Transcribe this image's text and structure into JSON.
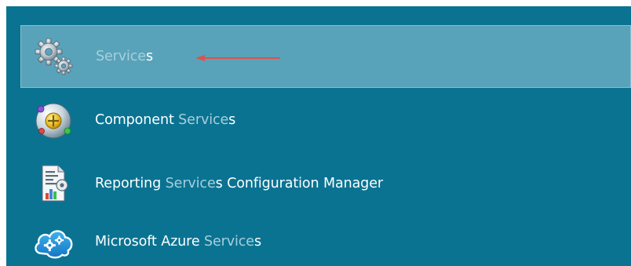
{
  "results": [
    {
      "id": "services",
      "prefix": "",
      "match": "Service",
      "suffix": "s",
      "selected": true,
      "icon": "gears-icon"
    },
    {
      "id": "component-services",
      "prefix": "Component ",
      "match": "Service",
      "suffix": "s",
      "selected": false,
      "icon": "component-services-icon"
    },
    {
      "id": "reporting-services",
      "prefix": "Reporting ",
      "match": "Service",
      "suffix": "s Configuration Manager",
      "selected": false,
      "icon": "report-config-icon"
    },
    {
      "id": "azure-services",
      "prefix": "Microsoft Azure ",
      "match": "Service",
      "suffix": "s",
      "selected": false,
      "icon": "azure-cloud-gear-icon"
    }
  ],
  "colors": {
    "background": "#0a7392",
    "selected": "#58a3ba",
    "match_text": "#a8cfdb",
    "arrow": "#d9534f"
  }
}
